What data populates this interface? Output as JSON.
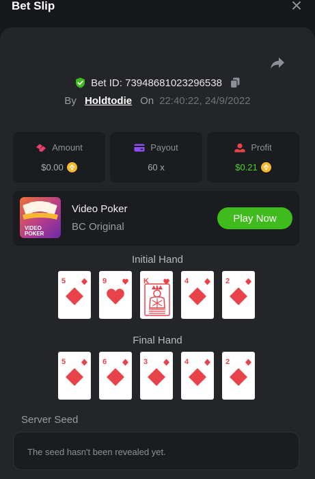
{
  "header": {
    "title": "Bet Slip"
  },
  "bet": {
    "id_text": "Bet ID: 73948681023296538",
    "by_label": "By",
    "username": "Holdtodie",
    "on_label": "On",
    "timestamp": "22:40:22, 24/9/2022"
  },
  "stats": [
    {
      "label": "Amount",
      "value": "$0.00",
      "icon": "amount-icon",
      "coin": true
    },
    {
      "label": "Payout",
      "value": "60 x",
      "icon": "payout-icon",
      "coin": false
    },
    {
      "label": "Profit",
      "value": "$0.21",
      "icon": "profit-icon",
      "coin": true
    }
  ],
  "game": {
    "name": "Video Poker",
    "provider": "BC Original",
    "thumb_text_line1": "VIDEO",
    "thumb_text_line2": "POKER",
    "play_label": "Play Now"
  },
  "initial_hand": {
    "title": "Initial Hand",
    "cards": [
      {
        "rank": "5",
        "suit": "diamond"
      },
      {
        "rank": "9",
        "suit": "heart"
      },
      {
        "rank": "K",
        "suit": "heart"
      },
      {
        "rank": "4",
        "suit": "diamond"
      },
      {
        "rank": "2",
        "suit": "diamond"
      }
    ]
  },
  "final_hand": {
    "title": "Final Hand",
    "cards": [
      {
        "rank": "5",
        "suit": "diamond"
      },
      {
        "rank": "6",
        "suit": "diamond"
      },
      {
        "rank": "3",
        "suit": "diamond"
      },
      {
        "rank": "4",
        "suit": "diamond"
      },
      {
        "rank": "2",
        "suit": "diamond"
      }
    ]
  },
  "server_seed": {
    "label": "Server Seed",
    "text": "The seed hasn't been revealed yet."
  },
  "colors": {
    "accent_green": "#3fbb1e",
    "profit_green": "#4ed12e",
    "card_red": "#e8434a",
    "amount_icon": "#e9406f",
    "payout_icon": "#8a4ff2",
    "profit_icon": "#e8434a",
    "coin": "#f3ba2f"
  }
}
